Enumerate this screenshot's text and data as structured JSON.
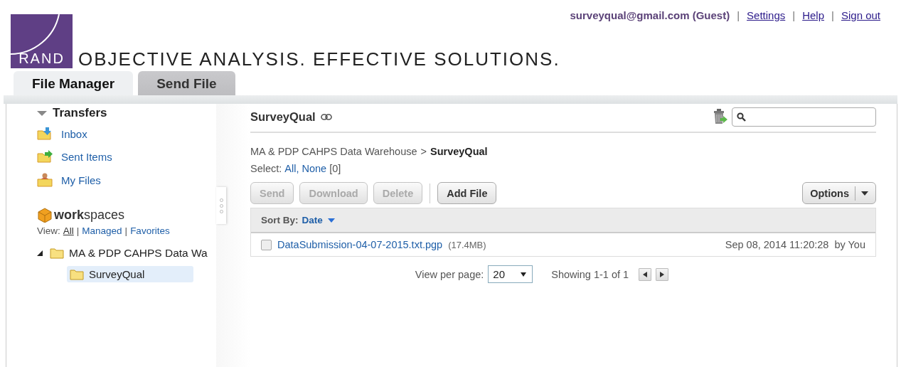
{
  "user": {
    "account": "surveyqual@gmail.com (Guest)",
    "separator": "|",
    "links": [
      {
        "label": "Settings"
      },
      {
        "label": "Help"
      },
      {
        "label": "Sign out"
      }
    ]
  },
  "logo": {
    "text": "RAND",
    "tagline": "OBJECTIVE ANALYSIS. EFFECTIVE SOLUTIONS."
  },
  "tabs": [
    {
      "label": "File Manager",
      "selected": true
    },
    {
      "label": "Send File",
      "selected": false
    }
  ],
  "sidebar": {
    "transfers": {
      "title": "Transfers",
      "expanded": true,
      "items": [
        {
          "label": "Inbox",
          "kind": "inbox"
        },
        {
          "label": "Sent Items",
          "kind": "sent"
        },
        {
          "label": "My Files",
          "kind": "myfiles"
        }
      ]
    },
    "workspaces": {
      "title": "**work**spaces",
      "view_label": "View:",
      "separator": "|",
      "view_options": [
        {
          "label": "All",
          "selected": true
        },
        {
          "label": "Managed",
          "selected": false
        },
        {
          "label": "Favorites",
          "selected": false
        }
      ],
      "tree": [
        {
          "label": "MA & PDP CAHPS Data Wa",
          "expanded": true,
          "selected": false,
          "children": [
            {
              "label": "SurveyQual",
              "selected": true
            }
          ]
        }
      ]
    }
  },
  "content": {
    "title": "SurveyQual",
    "breadcrumb": {
      "path": "MA & PDP CAHPS Data Warehouse",
      "separator": ">",
      "current": "SurveyQual"
    },
    "select": {
      "label": "Select:",
      "all": "All,",
      "none": "None",
      "count": "[0]"
    },
    "buttons": [
      {
        "label": "Send",
        "disabled": true
      },
      {
        "label": "Download",
        "disabled": true
      },
      {
        "label": "Delete",
        "disabled": true
      },
      {
        "label": "Add File",
        "disabled": false
      }
    ],
    "options": "Options",
    "sort": {
      "label": "Sort By:",
      "value": "Date"
    },
    "files": [
      {
        "name": "DataSubmission-04-07-2015.txt.pgp",
        "size": "(17.4MB)",
        "date": "Sep 08, 2014 11:20:28",
        "by": "by You",
        "checked": false
      }
    ],
    "pager": {
      "label": "View per page:",
      "value": "20",
      "status": "Showing 1-1 of 1"
    }
  }
}
